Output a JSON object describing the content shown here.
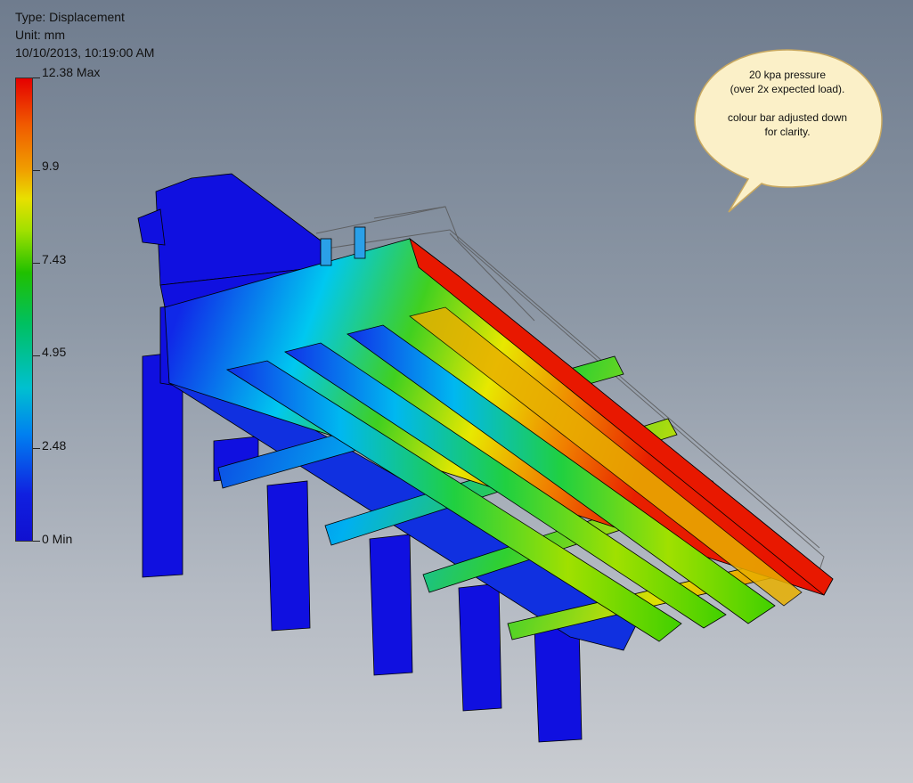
{
  "result": {
    "type_line": "Type: Displacement",
    "unit_line": "Unit: mm",
    "timestamp_line": "10/10/2013, 10:19:00 AM"
  },
  "legend": {
    "ticks": [
      "12.38 Max",
      "9.9",
      "7.43",
      "4.95",
      "2.48",
      "0 Min"
    ],
    "colors": {
      "max": "#e50000",
      "high": "#f0a000",
      "mid": "#20c000",
      "low": "#00c0d0",
      "min": "#1010d0"
    }
  },
  "callout": {
    "line1": "20 kpa pressure",
    "line2": "(over 2x expected load).",
    "line3": "colour bar adjusted down",
    "line4": "for clarity.",
    "fill": "#fbf0c8",
    "stroke": "#c8a860"
  },
  "model": {
    "description_icon": "fea-displacement-model",
    "palette": {
      "support": "#1010e0",
      "beam_low": "#00c0f0",
      "beam_mid": "#30d000",
      "beam_high": "#e8e000",
      "edge": "#e81800"
    }
  }
}
